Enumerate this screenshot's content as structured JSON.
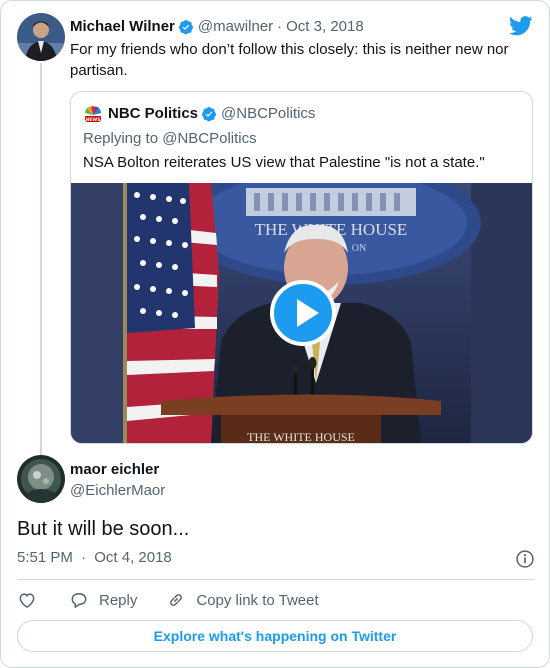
{
  "parent_tweet": {
    "display_name": "Michael Wilner",
    "handle": "@mawilner",
    "separator": "·",
    "date": "Oct 3, 2018",
    "text": "For my friends who don’t follow this closely: this is neither new nor partisan."
  },
  "quoted_tweet": {
    "display_name": "NBC Politics",
    "handle": "@NBCPolitics",
    "replying_to": "Replying to @NBCPolitics",
    "text": "NSA Bolton reiterates US view that Palestine \"is not a state.\"",
    "video_caption_top": "THE WHITE HOUSE",
    "video_caption_sub": "ON",
    "video_caption_bottom": "THE WHITE HOUSE"
  },
  "reply_tweet": {
    "display_name": "maor eichler",
    "handle": "@EichlerMaor",
    "text": "But it will be soon...",
    "time": "5:51 PM",
    "separator": "·",
    "date": "Oct 4, 2018"
  },
  "actions": {
    "reply_label": "Reply",
    "copy_link_label": "Copy link to Tweet"
  },
  "explore_label": "Explore what's happening on Twitter",
  "colors": {
    "twitter_blue": "#1d9bf0",
    "text_primary": "#0f1419",
    "text_secondary": "#536471",
    "border": "#cfd9de"
  },
  "icons": {
    "brand": "twitter-bird-icon",
    "verified": "verified-badge-icon",
    "play": "play-icon",
    "info": "info-icon",
    "like": "heart-icon",
    "reply": "reply-bubble-icon",
    "copy_link": "link-icon"
  }
}
